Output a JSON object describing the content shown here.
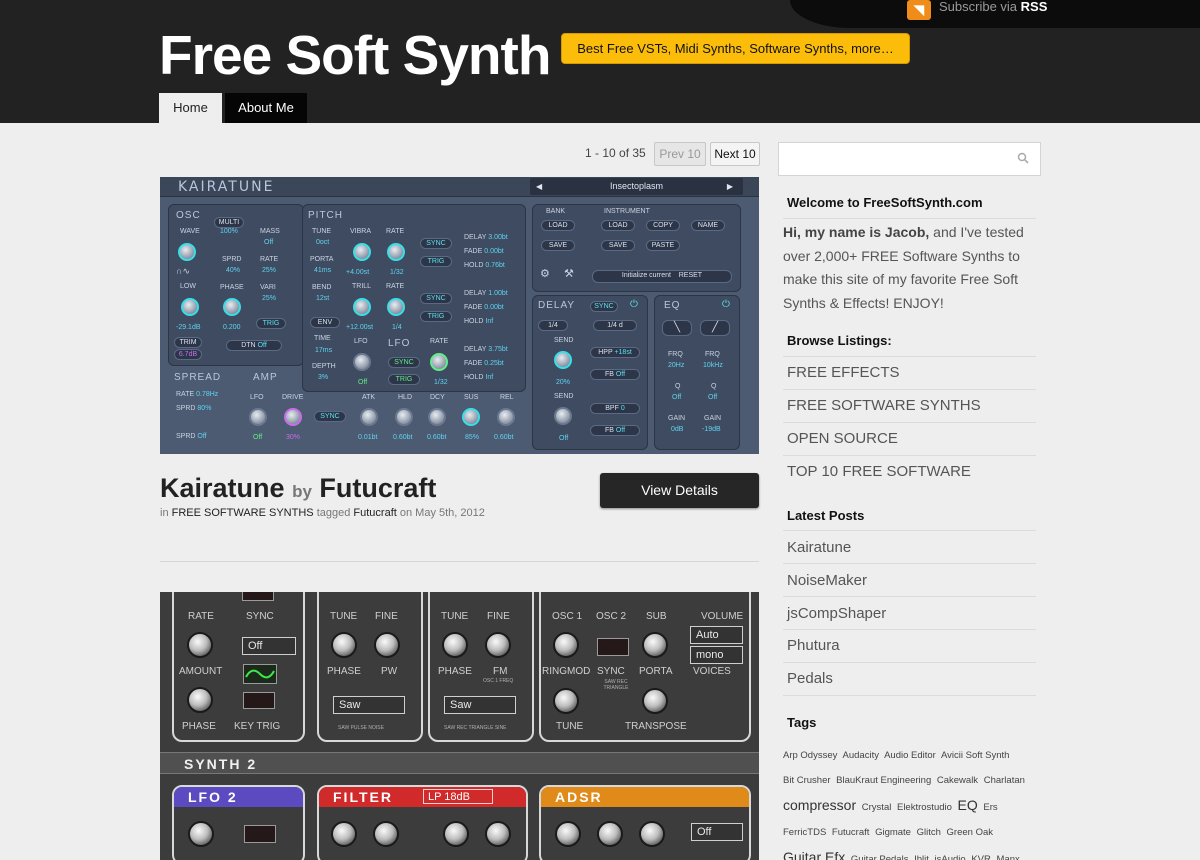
{
  "header": {
    "title": "Free Soft Synth",
    "tagline": "Best Free VSTs, Midi Synths, Software Synths, more…",
    "rss_prefix": "Subscribe via",
    "rss_label": "RSS",
    "nav": [
      {
        "label": "Home",
        "active": true
      },
      {
        "label": "About Me",
        "active": false
      }
    ]
  },
  "pagination": {
    "count_text": "1 - 10 of 35",
    "prev_label": "Prev 10",
    "next_label": "Next 10"
  },
  "kairatune_panel": {
    "logo": "KAIRATUNE",
    "preset": "Insectoplasm",
    "labels": {
      "osc": "OSC",
      "wave": "WAVE",
      "low": "LOW",
      "trim": "TRIM",
      "multi": "MULTI",
      "sprd": "SPRD",
      "phase": "PHASE",
      "mass": "MASS",
      "rate": "RATE",
      "vari": "VARI",
      "dtn": "DTN",
      "trig": "TRIG",
      "pitch": "PITCH",
      "tune": "TUNE",
      "porta": "PORTA",
      "bend": "BEND",
      "env": "ENV",
      "time": "TIME",
      "depth": "DEPTH",
      "vibra": "VIBRA",
      "trill": "TRILL",
      "lfo": "LFO",
      "sync": "SYNC",
      "delay": "DELAY",
      "fade": "FADE",
      "hold": "HOLD",
      "bank": "BANK",
      "instrument": "INSTRUMENT",
      "load": "LOAD",
      "save": "SAVE",
      "copy": "COPY",
      "name": "NAME",
      "paste": "PASTE",
      "init": "Initialize current",
      "reset": "RESET",
      "delay_sec": "DELAY",
      "eq": "EQ",
      "spread": "SPREAD",
      "amp": "AMP",
      "drive": "DRIVE",
      "atk": "ATK",
      "hld": "HLD",
      "dcy": "DCY",
      "sus": "SUS",
      "rel": "REL",
      "send": "SEND",
      "hpf": "HPF",
      "fb": "FB",
      "bpf": "BPF",
      "frq": "FRQ",
      "q": "Q",
      "gain": "GAIN"
    },
    "values": {
      "multi": "100%",
      "mass": "Off",
      "sprd": "40%",
      "rate": "25%",
      "vari": "25%",
      "low": "-29.1dB",
      "trim": "6.7dB",
      "phase": "0.200",
      "dtn": "Off",
      "tune": "0oct",
      "porta": "41ms",
      "bend": "12st",
      "time": "17ms",
      "depth": "3%",
      "vibra": "+4.00st",
      "vrate": "1/32",
      "trill": "+12.00st",
      "trate": "1/4",
      "lfo_on": "Off",
      "lrate": "1/32",
      "d1": "3.00bt",
      "f1": "0.00bt",
      "h1": "0.76bt",
      "d2": "1.00bt",
      "f2": "0.00bt",
      "h2": "Inf",
      "d3": "3.75bt",
      "f3": "0.25bt",
      "h3": "Inf",
      "dl_l": "1/4",
      "dl_r": "1/4 d",
      "send1": "20%",
      "hpp": "+18st",
      "fb1": "Off",
      "send2": "Off",
      "bpf": "0",
      "fb2": "Off",
      "frq1": "20Hz",
      "frq2": "10kHz",
      "q1": "Off",
      "q2": "Off",
      "g1": "0dB",
      "g2": "-19dB",
      "s_rate": "0.78Hz",
      "s_sprd": "80%",
      "s_sprd2": "Off",
      "lfo_amp": "Off",
      "drive": "30%",
      "atk": "0.01bt",
      "hld": "0.60bt",
      "dcy": "0.60bt",
      "sus": "85%",
      "rel": "0.60bt"
    }
  },
  "post": {
    "title": "Kairatune",
    "by": "by",
    "author": "Futucraft",
    "meta_in": "in",
    "category": "FREE SOFTWARE SYNTHS",
    "meta_tagged": "tagged",
    "tag": "Futucraft",
    "meta_on": "on May 5th, 2012",
    "button": "View Details"
  },
  "noisemaker_panel": {
    "labels": {
      "rate": "RATE",
      "sync": "SYNC",
      "amount": "AMOUNT",
      "phase": "PHASE",
      "key_trig": "KEY TRIG",
      "tune": "TUNE",
      "fine": "FINE",
      "pw": "PW",
      "fm": "FM",
      "osc1_freq": "OSC 1 FREQ",
      "osc1": "OSC 1",
      "osc2": "OSC 2",
      "sub": "SUB",
      "volume": "VOLUME",
      "ringmod": "RINGMOD",
      "porta": "PORTA",
      "voices": "VOICES",
      "transpose": "TRANSPOSE",
      "saw_pulse_noise": "SAW PULSE NOISE",
      "saw_rec_tri_sine": "SAW REC TRIANGLE SINE",
      "saw_rec_triangle": "SAW REC TRIANGLE",
      "synth2": "SYNTH 2",
      "lfo2": "LFO 2",
      "filter": "FILTER",
      "adsr": "ADSR",
      "lp": "LP 18dB",
      "off": "Off",
      "saw": "Saw",
      "auto": "Auto",
      "mono": "mono"
    }
  },
  "sidebar": {
    "search_placeholder": "",
    "welcome_heading": "Welcome to FreeSoftSynth.com",
    "intro_bold": "Hi, my name is Jacob,",
    "intro_rest": " and I've tested over 2,000+ FREE Software Synths to make this site of my favorite Free Soft Synths & Effects! ENJOY!",
    "browse_heading": "Browse Listings:",
    "browse": [
      "FREE EFFECTS",
      "FREE SOFTWARE SYNTHS",
      "OPEN SOURCE",
      "TOP 10 FREE SOFTWARE"
    ],
    "latest_heading": "Latest Posts",
    "latest": [
      "Kairatune",
      "NoiseMaker",
      "jsCompShaper",
      "Phutura",
      "Pedals"
    ],
    "tags_heading": "Tags",
    "tags": [
      {
        "t": "Arp Odyssey",
        "big": false
      },
      {
        "t": "Audacity",
        "big": false
      },
      {
        "t": "Audio Editor",
        "big": false
      },
      {
        "t": "Avicii Soft Synth",
        "big": false
      },
      {
        "t": "Bit Crusher",
        "big": false
      },
      {
        "t": "BlauKraut Engineering",
        "big": false
      },
      {
        "t": "Cakewalk",
        "big": false
      },
      {
        "t": "Charlatan",
        "big": false
      },
      {
        "t": "compressor",
        "big": true
      },
      {
        "t": "Crystal",
        "big": false
      },
      {
        "t": "Elektrostudio",
        "big": false
      },
      {
        "t": "EQ",
        "big": true
      },
      {
        "t": "Ers",
        "big": false
      },
      {
        "t": "FerricTDS",
        "big": false
      },
      {
        "t": "Futucraft",
        "big": false
      },
      {
        "t": "Gigmate",
        "big": false
      },
      {
        "t": "Glitch",
        "big": false
      },
      {
        "t": "Green Oak",
        "big": false
      },
      {
        "t": "Guitar Efx",
        "big": true
      },
      {
        "t": "Guitar Pedals",
        "big": false
      },
      {
        "t": "Iblit",
        "big": false
      },
      {
        "t": "jsAudio",
        "big": false
      },
      {
        "t": "KVR",
        "big": false
      },
      {
        "t": "Manx",
        "big": false
      }
    ]
  },
  "colors": {
    "header_bg": "#222222",
    "tagline_bg": "#fcbd0a",
    "page_bg": "#eeeeee",
    "button_bg": "#262626",
    "lfo2_color": "#5b4ac0",
    "filter_color": "#d02a2a",
    "adsr_color": "#e08a1a"
  }
}
